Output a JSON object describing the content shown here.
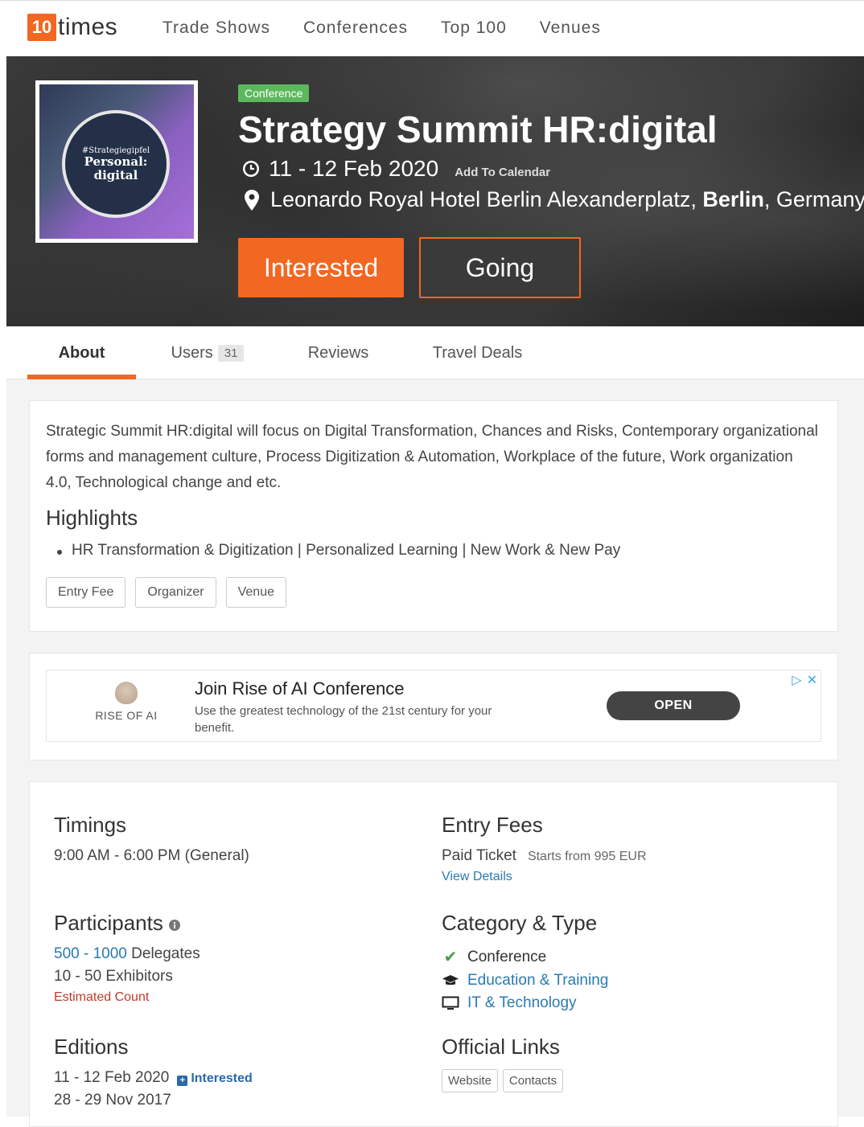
{
  "brand": {
    "logo_number": "10",
    "logo_word": "times",
    "accent": "#f26722"
  },
  "nav": {
    "items": [
      "Trade Shows",
      "Conferences",
      "Top 100",
      "Venues"
    ]
  },
  "poster": {
    "line1": "#Strategiegipfel",
    "line2": "Personal:",
    "line3": "digital"
  },
  "event": {
    "badge": "Conference",
    "title": "Strategy Summit HR:digital",
    "date": "11 - 12 Feb 2020",
    "add_to_calendar": "Add To Calendar",
    "venue": "Leonardo Royal Hotel Berlin Alexanderplatz,",
    "city": "Berlin",
    "country": ", Germany",
    "interested_label": "Interested",
    "going_label": "Going",
    "clock_icon": "clock-icon",
    "pin_icon": "map-pin-icon"
  },
  "tabs": [
    {
      "label": "About"
    },
    {
      "label": "Users",
      "count": "31"
    },
    {
      "label": "Reviews"
    },
    {
      "label": "Travel Deals"
    }
  ],
  "about": {
    "description": "Strategic Summit HR:digital will focus on Digital Transformation, Chances and Risks, Contemporary organizational forms and management culture, Process Digitization & Automation, Workplace of the future, Work organization 4.0, Technological change and etc.",
    "highlights_title": "Highlights",
    "highlight_item": "HR Transformation & Digitization | Personalized Learning | New Work & New Pay",
    "pills": [
      "Entry Fee",
      "Organizer",
      "Venue"
    ]
  },
  "ad": {
    "logo_text": "RISE OF AI",
    "title": "Join Rise of AI Conference",
    "subtitle": "Use the greatest technology of the 21st century for your benefit.",
    "button": "OPEN"
  },
  "timings": {
    "title": "Timings",
    "value": "9:00 AM - 6:00 PM (General)"
  },
  "entry_fees": {
    "title": "Entry Fees",
    "ticket": "Paid Ticket",
    "starts": "Starts from 995 EUR",
    "view_details": "View Details"
  },
  "participants": {
    "title": "Participants",
    "delegates_low": "500",
    "delegates_high": "1000",
    "delegates_sep": " - ",
    "delegates_label": " Delegates",
    "exhibitors": "10 - 50 Exhibitors",
    "estimated": "Estimated Count"
  },
  "category": {
    "title": "Category & Type",
    "items": [
      {
        "label": "Conference",
        "icon": "check-icon"
      },
      {
        "label": "Education & Training",
        "icon": "graduation-cap-icon"
      },
      {
        "label": "IT & Technology",
        "icon": "monitor-icon"
      }
    ]
  },
  "editions": {
    "title": "Editions",
    "first": "11 - 12 Feb 2020",
    "interested": "Interested",
    "second": "28 - 29 Nov 2017"
  },
  "official_links": {
    "title": "Official Links",
    "website": "Website",
    "contacts": "Contacts"
  }
}
